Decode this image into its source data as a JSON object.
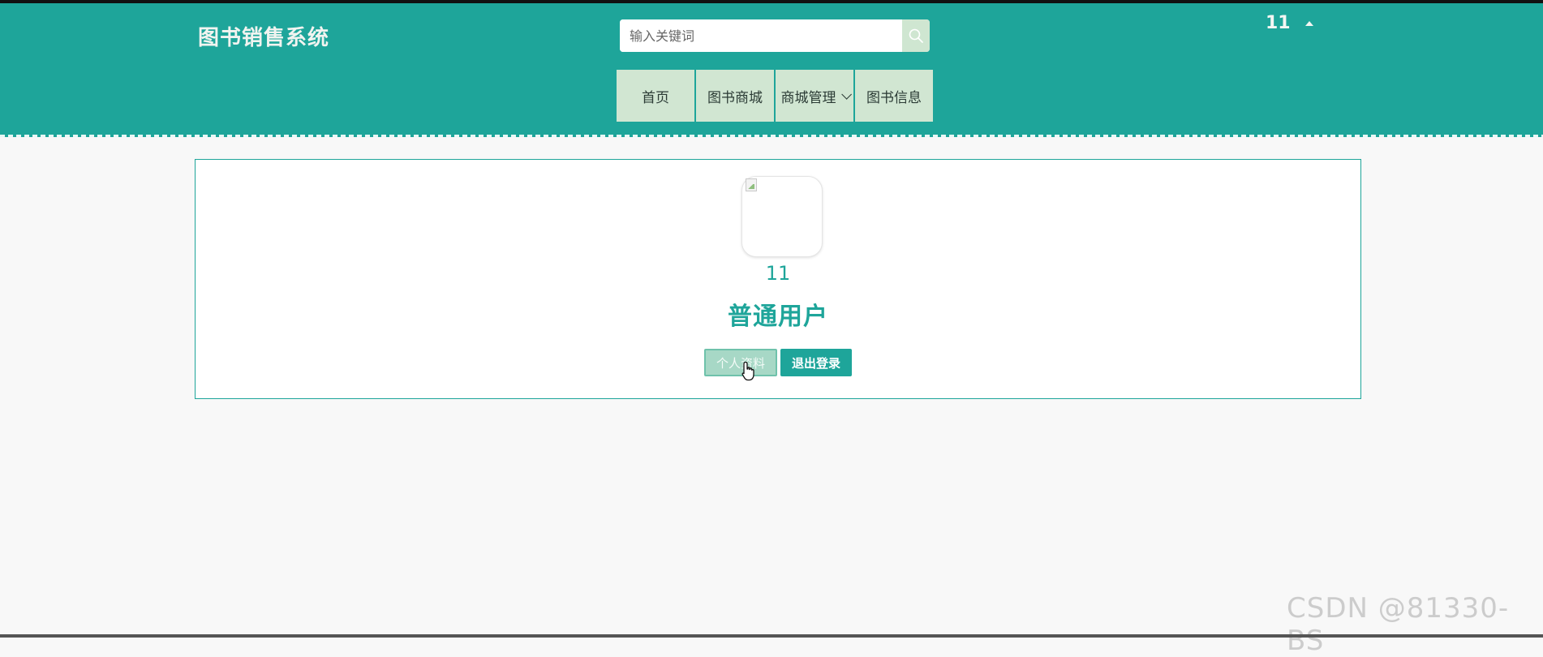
{
  "header": {
    "site_title": "图书销售系统",
    "search": {
      "placeholder": "输入关键词",
      "value": ""
    },
    "username": "11",
    "nav": [
      {
        "label": "首页"
      },
      {
        "label": "图书商城"
      },
      {
        "label": "商城管理",
        "has_dropdown": true
      },
      {
        "label": "图书信息"
      }
    ]
  },
  "profile": {
    "username": "11",
    "role": "普通用户",
    "profile_button": "个人资料",
    "logout_button": "退出登录"
  },
  "watermark": "CSDN @81330-BS",
  "colors": {
    "primary": "#1ea59a",
    "nav_bg": "#d1e6d2",
    "page_bg": "#f8f8f8"
  },
  "icons": {
    "search": "search-icon",
    "user_menu": "caret-up-icon",
    "dropdown": "chevron-down-icon",
    "cursor": "hand-pointer-icon"
  }
}
